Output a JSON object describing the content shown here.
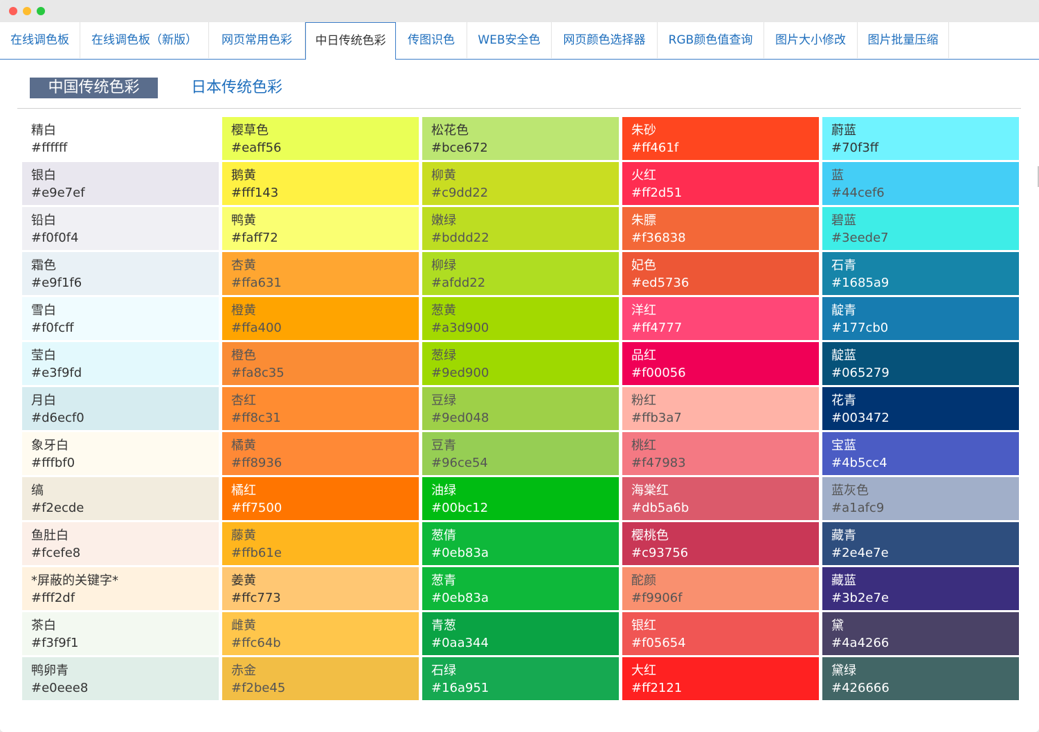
{
  "window": {
    "controls": [
      "close",
      "minimize",
      "maximize"
    ]
  },
  "tabs": [
    {
      "label": "在线调色板",
      "active": false
    },
    {
      "label": "在线调色板（新版）",
      "active": false
    },
    {
      "label": "网页常用色彩",
      "active": false
    },
    {
      "label": "中日传统色彩",
      "active": true
    },
    {
      "label": "传图识色",
      "active": false
    },
    {
      "label": "WEB安全色",
      "active": false
    },
    {
      "label": "网页颜色选择器",
      "active": false
    },
    {
      "label": "RGB颜色值查询",
      "active": false
    },
    {
      "label": "图片大小修改",
      "active": false
    },
    {
      "label": "图片批量压缩",
      "active": false
    }
  ],
  "subtabs": {
    "active": "中国传统色彩",
    "other": "日本传统色彩"
  },
  "colors": {
    "columns": [
      [
        {
          "name": "精白",
          "hex": "#ffffff"
        },
        {
          "name": "银白",
          "hex": "#e9e7ef"
        },
        {
          "name": "铅白",
          "hex": "#f0f0f4"
        },
        {
          "name": "霜色",
          "hex": "#e9f1f6"
        },
        {
          "name": "雪白",
          "hex": "#f0fcff"
        },
        {
          "name": "莹白",
          "hex": "#e3f9fd"
        },
        {
          "name": "月白",
          "hex": "#d6ecf0"
        },
        {
          "name": "象牙白",
          "hex": "#fffbf0"
        },
        {
          "name": "缟",
          "hex": "#f2ecde"
        },
        {
          "name": "鱼肚白",
          "hex": "#fcefe8"
        },
        {
          "name": "*屏蔽的关键字*",
          "hex": "#fff2df"
        },
        {
          "name": "茶白",
          "hex": "#f3f9f1"
        },
        {
          "name": "鸭卵青",
          "hex": "#e0eee8"
        }
      ],
      [
        {
          "name": "樱草色",
          "hex": "#eaff56"
        },
        {
          "name": "鹅黄",
          "hex": "#fff143"
        },
        {
          "name": "鸭黄",
          "hex": "#faff72"
        },
        {
          "name": "杏黄",
          "hex": "#ffa631"
        },
        {
          "name": "橙黄",
          "hex": "#ffa400"
        },
        {
          "name": "橙色",
          "hex": "#fa8c35"
        },
        {
          "name": "杏红",
          "hex": "#ff8c31"
        },
        {
          "name": "橘黄",
          "hex": "#ff8936"
        },
        {
          "name": "橘红",
          "hex": "#ff7500"
        },
        {
          "name": "藤黄",
          "hex": "#ffb61e"
        },
        {
          "name": "姜黄",
          "hex": "#ffc773"
        },
        {
          "name": "雌黄",
          "hex": "#ffc64b"
        },
        {
          "name": "赤金",
          "hex": "#f2be45"
        }
      ],
      [
        {
          "name": "松花色",
          "hex": "#bce672"
        },
        {
          "name": "柳黄",
          "hex": "#c9dd22"
        },
        {
          "name": "嫩绿",
          "hex": "#bddd22"
        },
        {
          "name": "柳绿",
          "hex": "#afdd22"
        },
        {
          "name": "葱黄",
          "hex": "#a3d900"
        },
        {
          "name": "葱绿",
          "hex": "#9ed900"
        },
        {
          "name": "豆绿",
          "hex": "#9ed048"
        },
        {
          "name": "豆青",
          "hex": "#96ce54"
        },
        {
          "name": "油绿",
          "hex": "#00bc12"
        },
        {
          "name": "葱倩",
          "hex": "#0eb83a"
        },
        {
          "name": "葱青",
          "hex": "#0eb83a"
        },
        {
          "name": "青葱",
          "hex": "#0aa344"
        },
        {
          "name": "石绿",
          "hex": "#16a951"
        }
      ],
      [
        {
          "name": "朱砂",
          "hex": "#ff461f"
        },
        {
          "name": "火红",
          "hex": "#ff2d51"
        },
        {
          "name": "朱膘",
          "hex": "#f36838"
        },
        {
          "name": "妃色",
          "hex": "#ed5736"
        },
        {
          "name": "洋红",
          "hex": "#ff4777"
        },
        {
          "name": "品红",
          "hex": "#f00056"
        },
        {
          "name": "粉红",
          "hex": "#ffb3a7"
        },
        {
          "name": "桃红",
          "hex": "#f47983"
        },
        {
          "name": "海棠红",
          "hex": "#db5a6b"
        },
        {
          "name": "樱桃色",
          "hex": "#c93756"
        },
        {
          "name": "酡颜",
          "hex": "#f9906f"
        },
        {
          "name": "银红",
          "hex": "#f05654"
        },
        {
          "name": "大红",
          "hex": "#ff2121"
        }
      ],
      [
        {
          "name": "蔚蓝",
          "hex": "#70f3ff"
        },
        {
          "name": "蓝",
          "hex": "#44cef6"
        },
        {
          "name": "碧蓝",
          "hex": "#3eede7"
        },
        {
          "name": "石青",
          "hex": "#1685a9"
        },
        {
          "name": "靛青",
          "hex": "#177cb0"
        },
        {
          "name": "靛蓝",
          "hex": "#065279"
        },
        {
          "name": "花青",
          "hex": "#003472"
        },
        {
          "name": "宝蓝",
          "hex": "#4b5cc4"
        },
        {
          "name": "蓝灰色",
          "hex": "#a1afc9"
        },
        {
          "name": "藏青",
          "hex": "#2e4e7e"
        },
        {
          "name": "藏蓝",
          "hex": "#3b2e7e"
        },
        {
          "name": "黛",
          "hex": "#4a4266"
        },
        {
          "name": "黛绿",
          "hex": "#426666"
        }
      ]
    ]
  }
}
